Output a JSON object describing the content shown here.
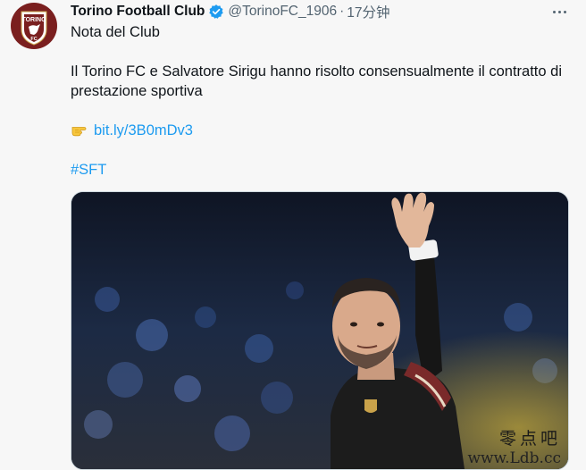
{
  "author": {
    "display_name": "Torino Football Club",
    "handle": "@TorinoFC_1906",
    "separator": "·",
    "timestamp": "17分钟",
    "avatar_text": "TORINO",
    "avatar_subtext": "FC"
  },
  "tweet": {
    "line1": "Nota del Club",
    "line2": "Il Torino FC e Salvatore Sirigu hanno risolto consensualmente il contratto di",
    "line3": "prestazione sportiva",
    "link_text": "bit.ly/3B0mDv3",
    "hashtag": "#SFT"
  },
  "icons": {
    "verified": "verified-badge-icon",
    "more": "more-options-icon",
    "pointer": "pointing-hand-emoji"
  },
  "watermark": {
    "chinese": "零点吧",
    "url": "www.Ldb.cc"
  },
  "colors": {
    "link": "#1d9bf0",
    "club_maroon": "#7a1f1f",
    "secondary_text": "#536471"
  }
}
